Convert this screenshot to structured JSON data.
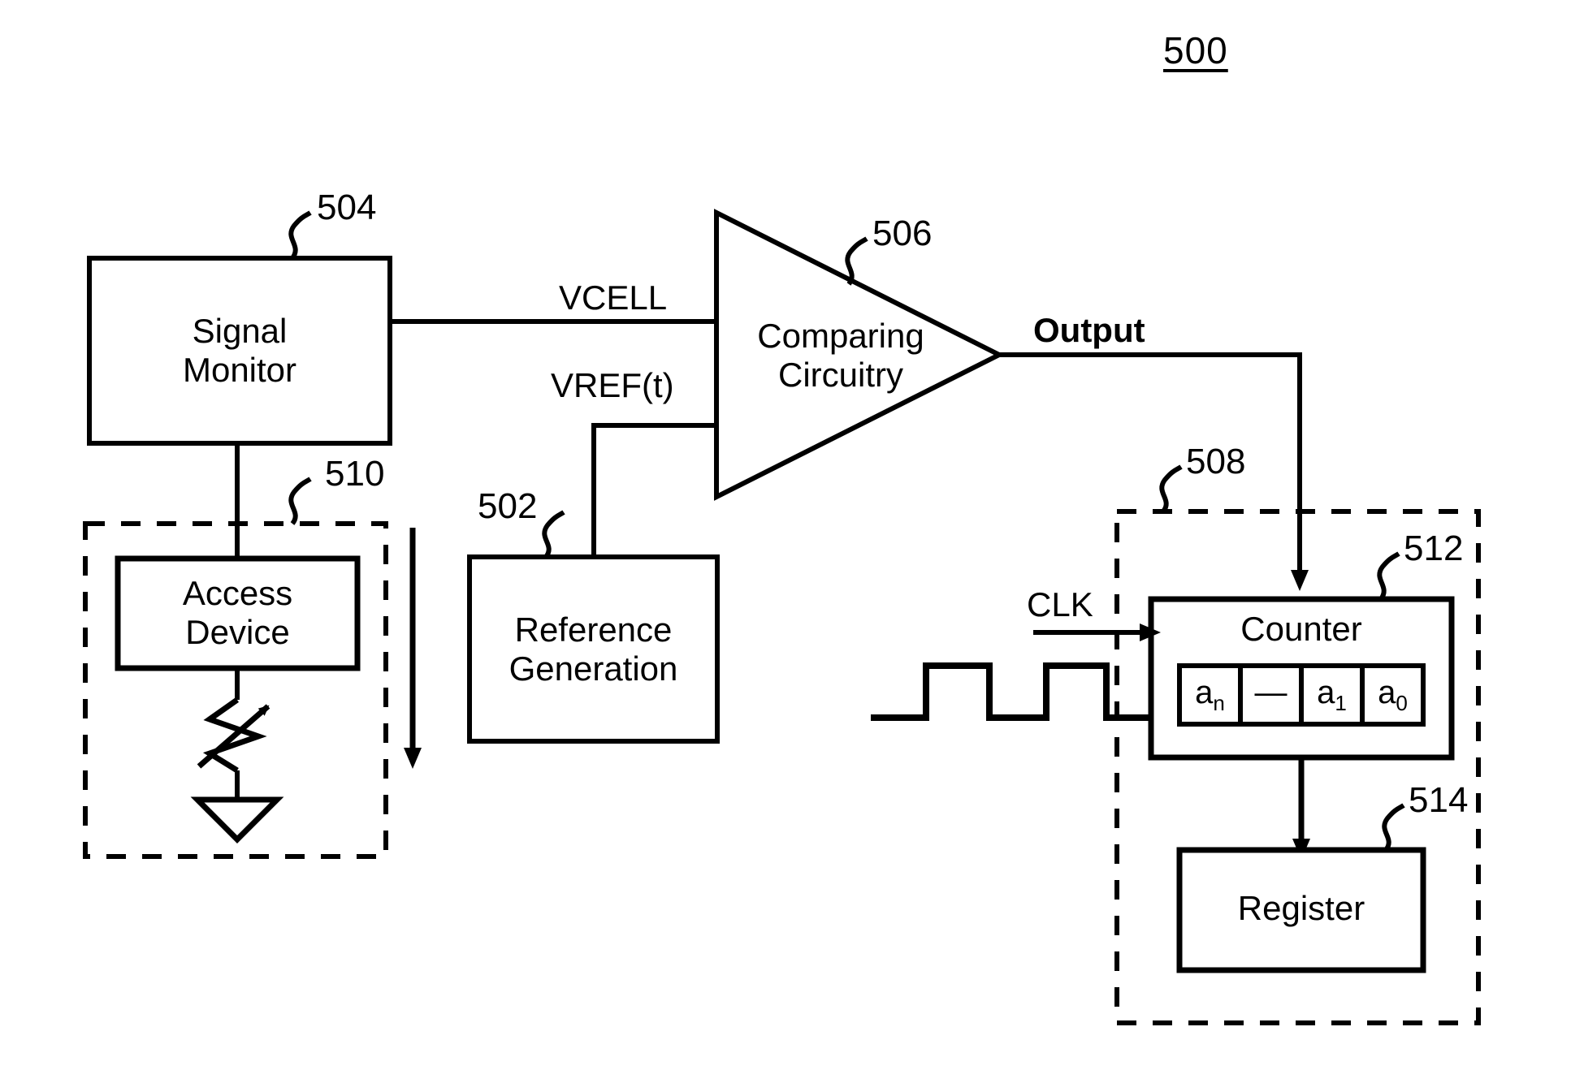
{
  "figure": {
    "title": "500"
  },
  "blocks": {
    "signal_monitor": {
      "label_line1": "Signal",
      "label_line2": "Monitor",
      "ref": "504"
    },
    "access_device": {
      "label_line1": "Access",
      "label_line2": "Device",
      "ref": ""
    },
    "reference_generation": {
      "label_line1": "Reference",
      "label_line2": "Generation",
      "ref": "502"
    },
    "comparing_circuitry": {
      "label_line1": "Comparing",
      "label_line2": "Circuitry",
      "ref": "506"
    },
    "counter": {
      "label": "Counter",
      "ref": "512"
    },
    "register": {
      "label": "Register",
      "ref": "514"
    }
  },
  "groups": {
    "memory_cell_group": {
      "ref": "510"
    },
    "digitizer_group": {
      "ref": "508"
    }
  },
  "signals": {
    "vcell": "VCELL",
    "vref": "VREF(t)",
    "output": "Output",
    "clk": "CLK"
  },
  "counter_cells": [
    {
      "base": "a",
      "sub": "n"
    },
    {
      "base": "—",
      "sub": ""
    },
    {
      "base": "a",
      "sub": "1"
    },
    {
      "base": "a",
      "sub": "0"
    }
  ],
  "colors": {
    "stroke": "#000000",
    "background": "#ffffff"
  }
}
